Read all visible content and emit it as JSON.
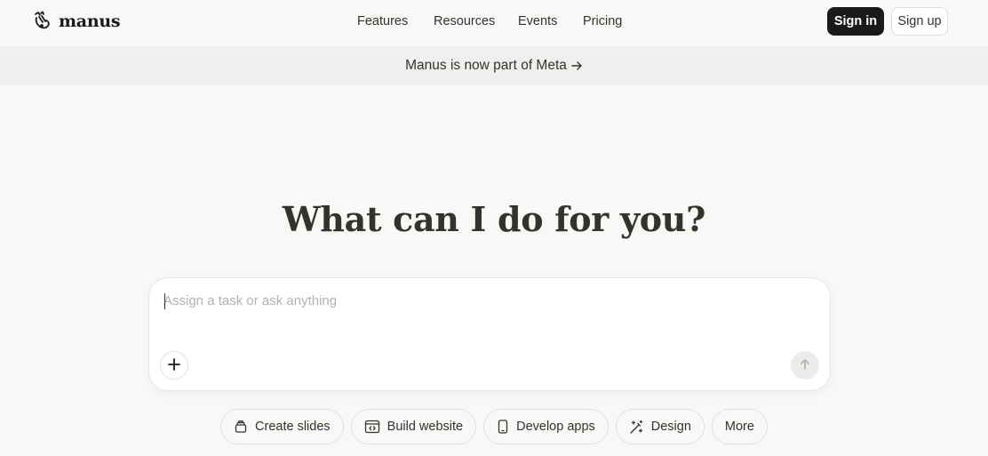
{
  "header": {
    "brand": "manus",
    "brand_icon": "manus-hand-logo-icon",
    "nav": [
      "Features",
      "Resources",
      "Events",
      "Pricing"
    ],
    "sign_in": "Sign in",
    "sign_up": "Sign up"
  },
  "banner": {
    "text": "Manus is now part of Meta",
    "icon": "arrow-right-icon"
  },
  "hero": {
    "title": "What can I do for you?"
  },
  "composer": {
    "placeholder": "Assign a task or ask anything",
    "value": "",
    "add_icon": "plus-icon",
    "send_icon": "arrow-up-icon"
  },
  "actions": [
    {
      "label": "Create slides",
      "icon": "slides-icon"
    },
    {
      "label": "Build website",
      "icon": "browser-code-icon"
    },
    {
      "label": "Develop apps",
      "icon": "mobile-phone-icon"
    },
    {
      "label": "Design",
      "icon": "magic-wand-icon"
    },
    {
      "label": "More",
      "icon": ""
    }
  ],
  "colors": {
    "background": "#f8f8f7",
    "banner_bg": "#efefed",
    "text": "#34322d",
    "primary_button": "#1a1a19"
  }
}
